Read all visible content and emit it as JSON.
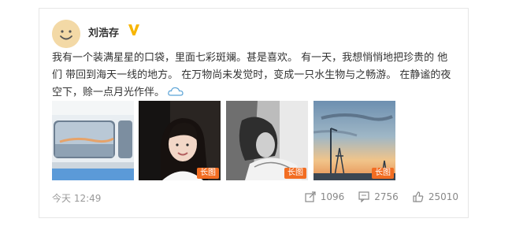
{
  "post": {
    "username": "刘浩存",
    "text_main": "我有一个装满星星的口袋，里面七彩斑斓。甚是喜欢。 有一天，我想悄悄地把珍贵的 他们 带回到海天一线的地方。 在万物尚未发觉时，变成一只水生物与之畅游。 在静谧的夜空下，赊一点月光作伴。",
    "images": [
      {
        "alt": "bus window sky"
      },
      {
        "alt": "selfie in car"
      },
      {
        "alt": "black and white portrait",
        "badge": "长图"
      },
      {
        "alt": "sunset sky with power tower",
        "badge": "长图"
      }
    ],
    "image_badge_2": "长图",
    "time": "今天 12:49",
    "actions": {
      "share_count": "1096",
      "comment_count": "2756",
      "like_count": "25010"
    }
  },
  "colors": {
    "accent_badge": "#f26d22",
    "vip_badge": "#f7b500",
    "meta_text": "#999999"
  }
}
